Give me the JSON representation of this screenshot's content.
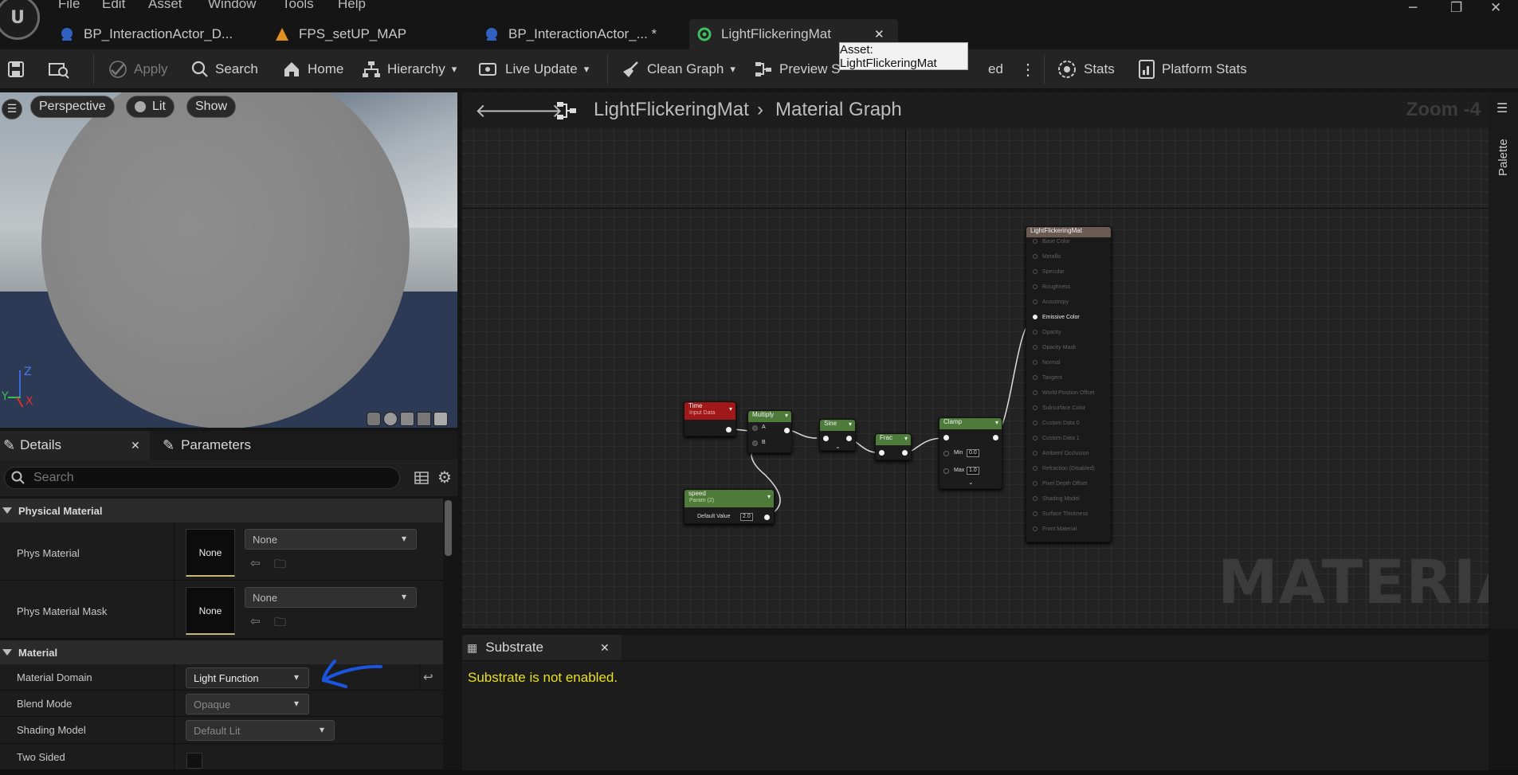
{
  "menu": {
    "items": [
      "File",
      "Edit",
      "Asset",
      "Window",
      "Tools",
      "Help"
    ]
  },
  "tabs": [
    {
      "label": "BP_InteractionActor_D...",
      "icon": "blueprint-icon",
      "color": "#3060c0"
    },
    {
      "label": "FPS_setUP_MAP",
      "icon": "level-icon",
      "color": "#e09020"
    },
    {
      "label": "BP_InteractionActor_... *",
      "icon": "blueprint-icon",
      "color": "#3060c0"
    },
    {
      "label": "LightFlickeringMat",
      "icon": "material-icon",
      "color": "#40c060",
      "active": true
    }
  ],
  "tooltip": "Asset: LightFlickeringMat",
  "toolbar": {
    "apply": "Apply",
    "search": "Search",
    "home": "Home",
    "hierarchy": "Hierarchy",
    "live_update": "Live Update",
    "clean_graph": "Clean Graph",
    "preview": "Preview S",
    "hidden_label": "ed",
    "stats": "Stats",
    "platform_stats": "Platform Stats"
  },
  "viewport": {
    "perspective": "Perspective",
    "lit": "Lit",
    "show": "Show",
    "axis_z": "Z",
    "axis_y": "Y",
    "axis_x": "X"
  },
  "details_panel": {
    "tab_details": "Details",
    "tab_parameters": "Parameters",
    "search_placeholder": "Search",
    "categories": {
      "physical_material": "Physical Material",
      "material": "Material"
    },
    "phys_material": {
      "label": "Phys Material",
      "thumb": "None",
      "value": "None"
    },
    "phys_material_mask": {
      "label": "Phys Material Mask",
      "thumb": "None",
      "value": "None"
    },
    "material_domain": {
      "label": "Material Domain",
      "value": "Light Function"
    },
    "blend_mode": {
      "label": "Blend Mode",
      "value": "Opaque"
    },
    "shading_model": {
      "label": "Shading Model",
      "value": "Default Lit"
    },
    "two_sided": {
      "label": "Two Sided",
      "checked": false
    }
  },
  "graph": {
    "breadcrumb_asset": "LightFlickeringMat",
    "breadcrumb_graph": "Material Graph",
    "zoom": "Zoom -4",
    "watermark": "MATERIAL",
    "palette": "Palette",
    "nodes": {
      "time": {
        "title": "Time",
        "subtitle": "Input Data"
      },
      "multiply": {
        "title": "Multiply",
        "pin_a": "A",
        "pin_b": "B"
      },
      "sine": {
        "title": "Sine"
      },
      "frac": {
        "title": "Frac"
      },
      "clamp": {
        "title": "Clamp",
        "min_label": "Min",
        "min_value": "0.0",
        "max_label": "Max",
        "max_value": "1.0"
      },
      "speed": {
        "title": "speed",
        "subtitle": "Param (2)",
        "default_label": "Default Value",
        "default_value": "2.0"
      },
      "result": {
        "title": "LightFlickeringMat",
        "pins": [
          "Base Color",
          "Metallic",
          "Specular",
          "Roughness",
          "Anisotropy",
          "Emissive Color",
          "Opacity",
          "Opacity Mask",
          "Normal",
          "Tangent",
          "World Position Offset",
          "Subsurface Color",
          "Custom Data 0",
          "Custom Data 1",
          "Ambient Occlusion",
          "Refraction (Disabled)",
          "Pixel Depth Offset",
          "Shading Model",
          "Surface Thickness",
          "Front Material"
        ],
        "active_pin": "Emissive Color"
      }
    }
  },
  "substrate": {
    "tab": "Substrate",
    "message": "Substrate is not enabled."
  },
  "colors": {
    "accent_blue": "#1a55e0",
    "message_yellow": "#e8e020",
    "node_time": "#a01818",
    "node_green": "#4e7a3a",
    "node_result": "#6a5a52"
  }
}
